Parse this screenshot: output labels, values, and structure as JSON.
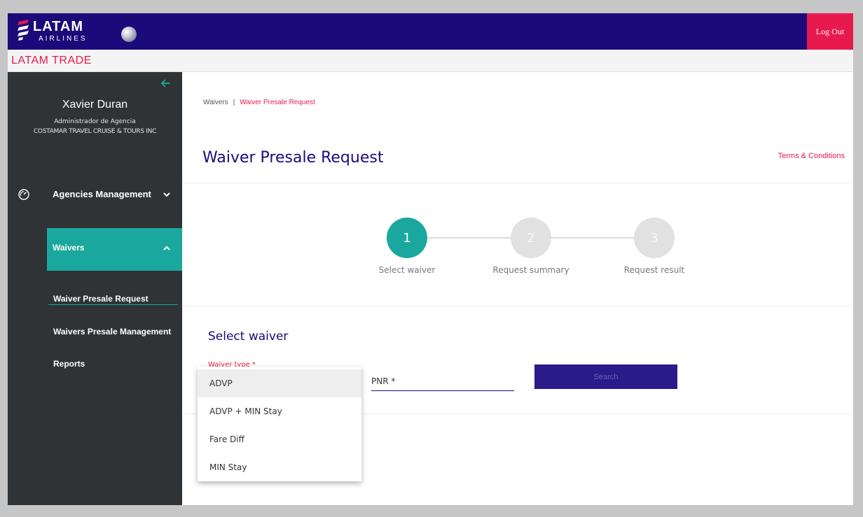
{
  "header": {
    "logo_main": "LATAM",
    "logo_sub": "AIRLINES",
    "logout_label": "Log Out",
    "trade_title": "LATAM TRADE",
    "colors": {
      "brand": "#1c0a7a",
      "accent": "#e8194e",
      "teal": "#1aa89e",
      "sidebar": "#2f3336"
    }
  },
  "sidebar": {
    "collapse_icon": "arrow-left-icon",
    "user": {
      "name": "Xavier Duran",
      "role": "Administrador de Agencia",
      "agency": "COSTAMAR TRAVEL CRUISE & TOURS INC"
    },
    "nav": {
      "agencies": {
        "label": "Agencies Management",
        "icon": "dashboard-icon"
      },
      "waivers": {
        "label": "Waivers"
      },
      "sub_items": [
        "Waiver Presale Request",
        "Waivers Presale Management",
        "Reports"
      ]
    }
  },
  "main": {
    "breadcrumb": {
      "root": "Waivers",
      "sep": "|",
      "current": "Waiver Presale Request"
    },
    "title": "Waiver Presale Request",
    "terms": "Terms & Conditions",
    "steps": [
      {
        "number": "1",
        "label": "Select waiver"
      },
      {
        "number": "2",
        "label": "Request summary"
      },
      {
        "number": "3",
        "label": "Request result"
      }
    ],
    "form": {
      "section_title": "Select waiver",
      "waiver_type_label": "Waiver type *",
      "pnr_label": "PNR *",
      "search_label": "Search"
    },
    "dropdown": {
      "options": [
        "ADVP",
        "ADVP + MIN Stay",
        "Fare Diff",
        "MIN Stay"
      ],
      "selected": "ADVP"
    }
  }
}
